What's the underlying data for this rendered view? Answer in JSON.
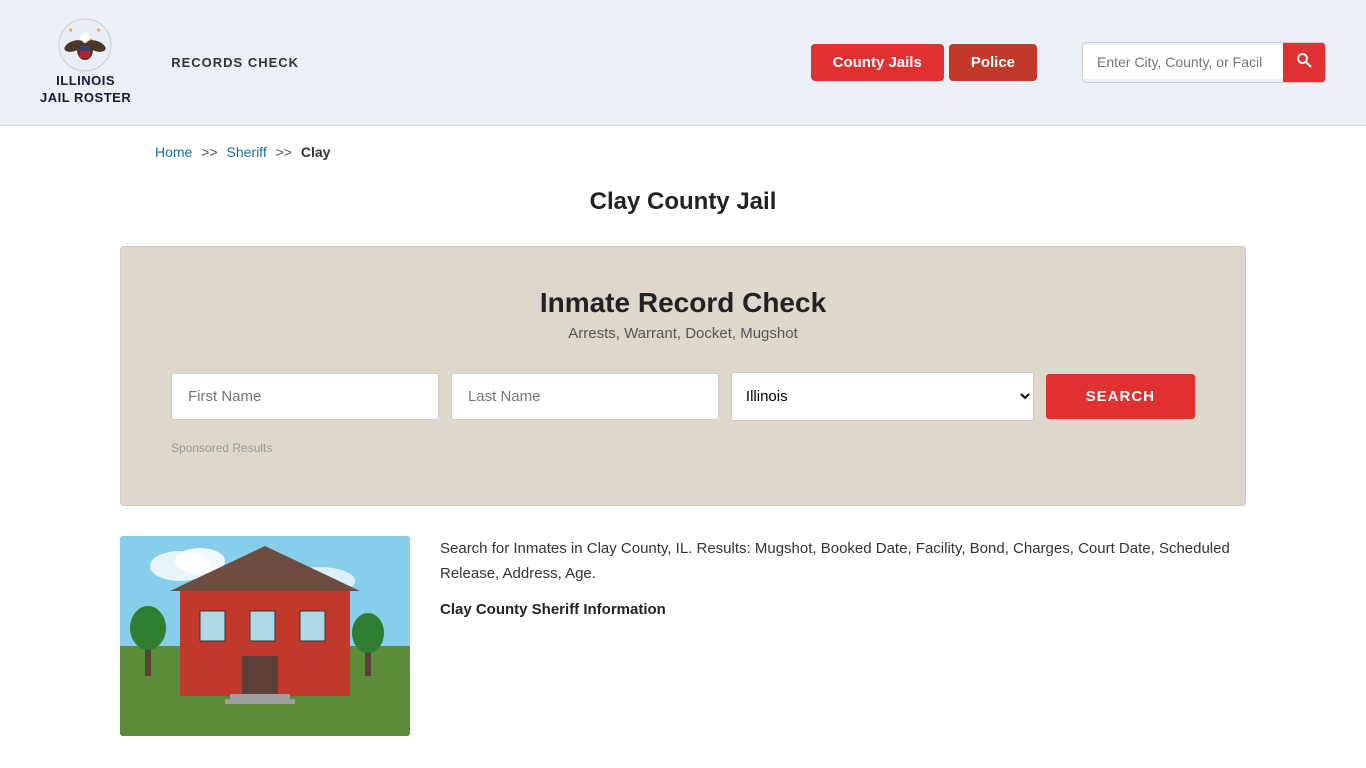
{
  "header": {
    "logo_text": "ILLINOIS\nJAIL ROSTER",
    "records_check_label": "RECORDS CHECK",
    "nav_buttons": [
      {
        "label": "County Jails",
        "active": true
      },
      {
        "label": "Police",
        "active": false
      }
    ],
    "search_placeholder": "Enter City, County, or Facil"
  },
  "breadcrumb": {
    "home": "Home",
    "sep1": ">>",
    "sheriff": "Sheriff",
    "sep2": ">>",
    "current": "Clay"
  },
  "page_title": "Clay County Jail",
  "record_check": {
    "title": "Inmate Record Check",
    "subtitle": "Arrests, Warrant, Docket, Mugshot",
    "first_name_placeholder": "First Name",
    "last_name_placeholder": "Last Name",
    "state_default": "Illinois",
    "search_label": "SEARCH",
    "sponsored_text": "Sponsored Results"
  },
  "content": {
    "description": "Search for Inmates in Clay County, IL. Results: Mugshot, Booked Date, Facility, Bond, Charges, Court Date, Scheduled Release, Address, Age.",
    "sheriff_info_title": "Clay County Sheriff Information"
  }
}
